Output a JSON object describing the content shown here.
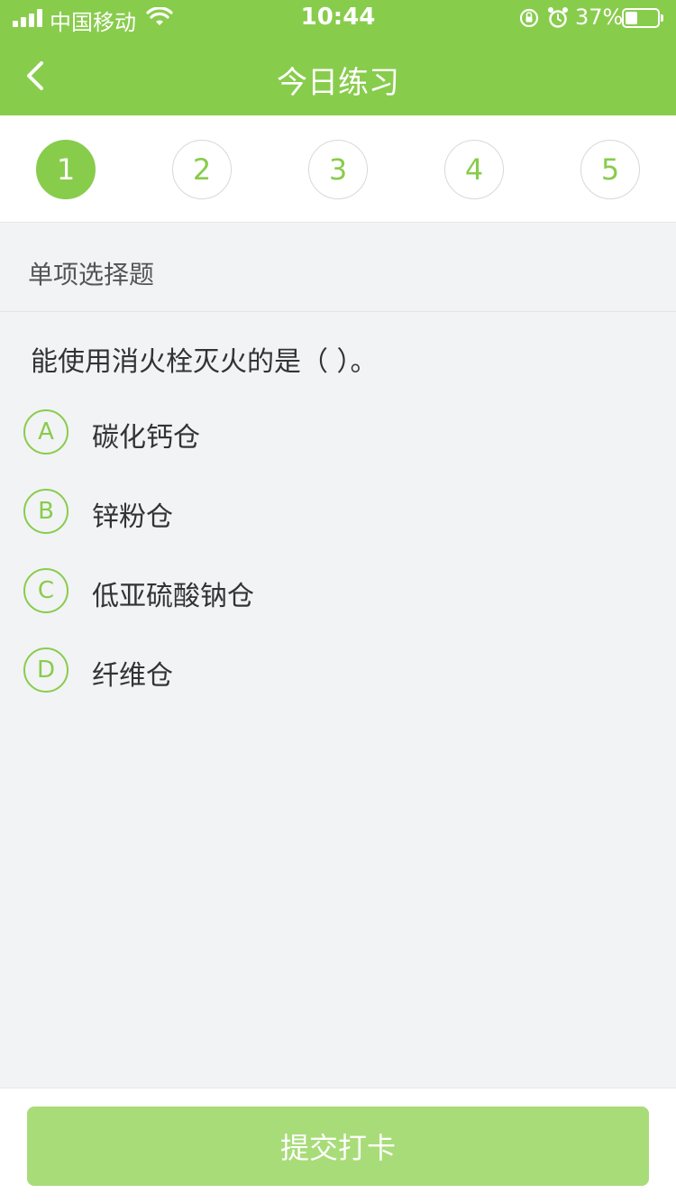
{
  "status_bar": {
    "carrier": "中国移动",
    "time": "10:44",
    "battery_percent": "37%",
    "battery_level": 0.37
  },
  "nav": {
    "title": "今日练习",
    "back_icon": "chevron-left-icon"
  },
  "question_numbers": [
    "1",
    "2",
    "3",
    "4",
    "5"
  ],
  "active_question": 1,
  "question_type": "单项选择题",
  "question": {
    "text": "能使用消火栓灭火的是（    ）。",
    "options": [
      {
        "letter": "A",
        "text": "碳化钙仓"
      },
      {
        "letter": "B",
        "text": "锌粉仓"
      },
      {
        "letter": "C",
        "text": "低亚硫酸钠仓"
      },
      {
        "letter": "D",
        "text": "纤维仓"
      }
    ]
  },
  "submit_label": "提交打卡",
  "colors": {
    "primary": "#88cc4c",
    "submit_bg": "#a8dc78",
    "page_bg": "#f2f3f5"
  }
}
